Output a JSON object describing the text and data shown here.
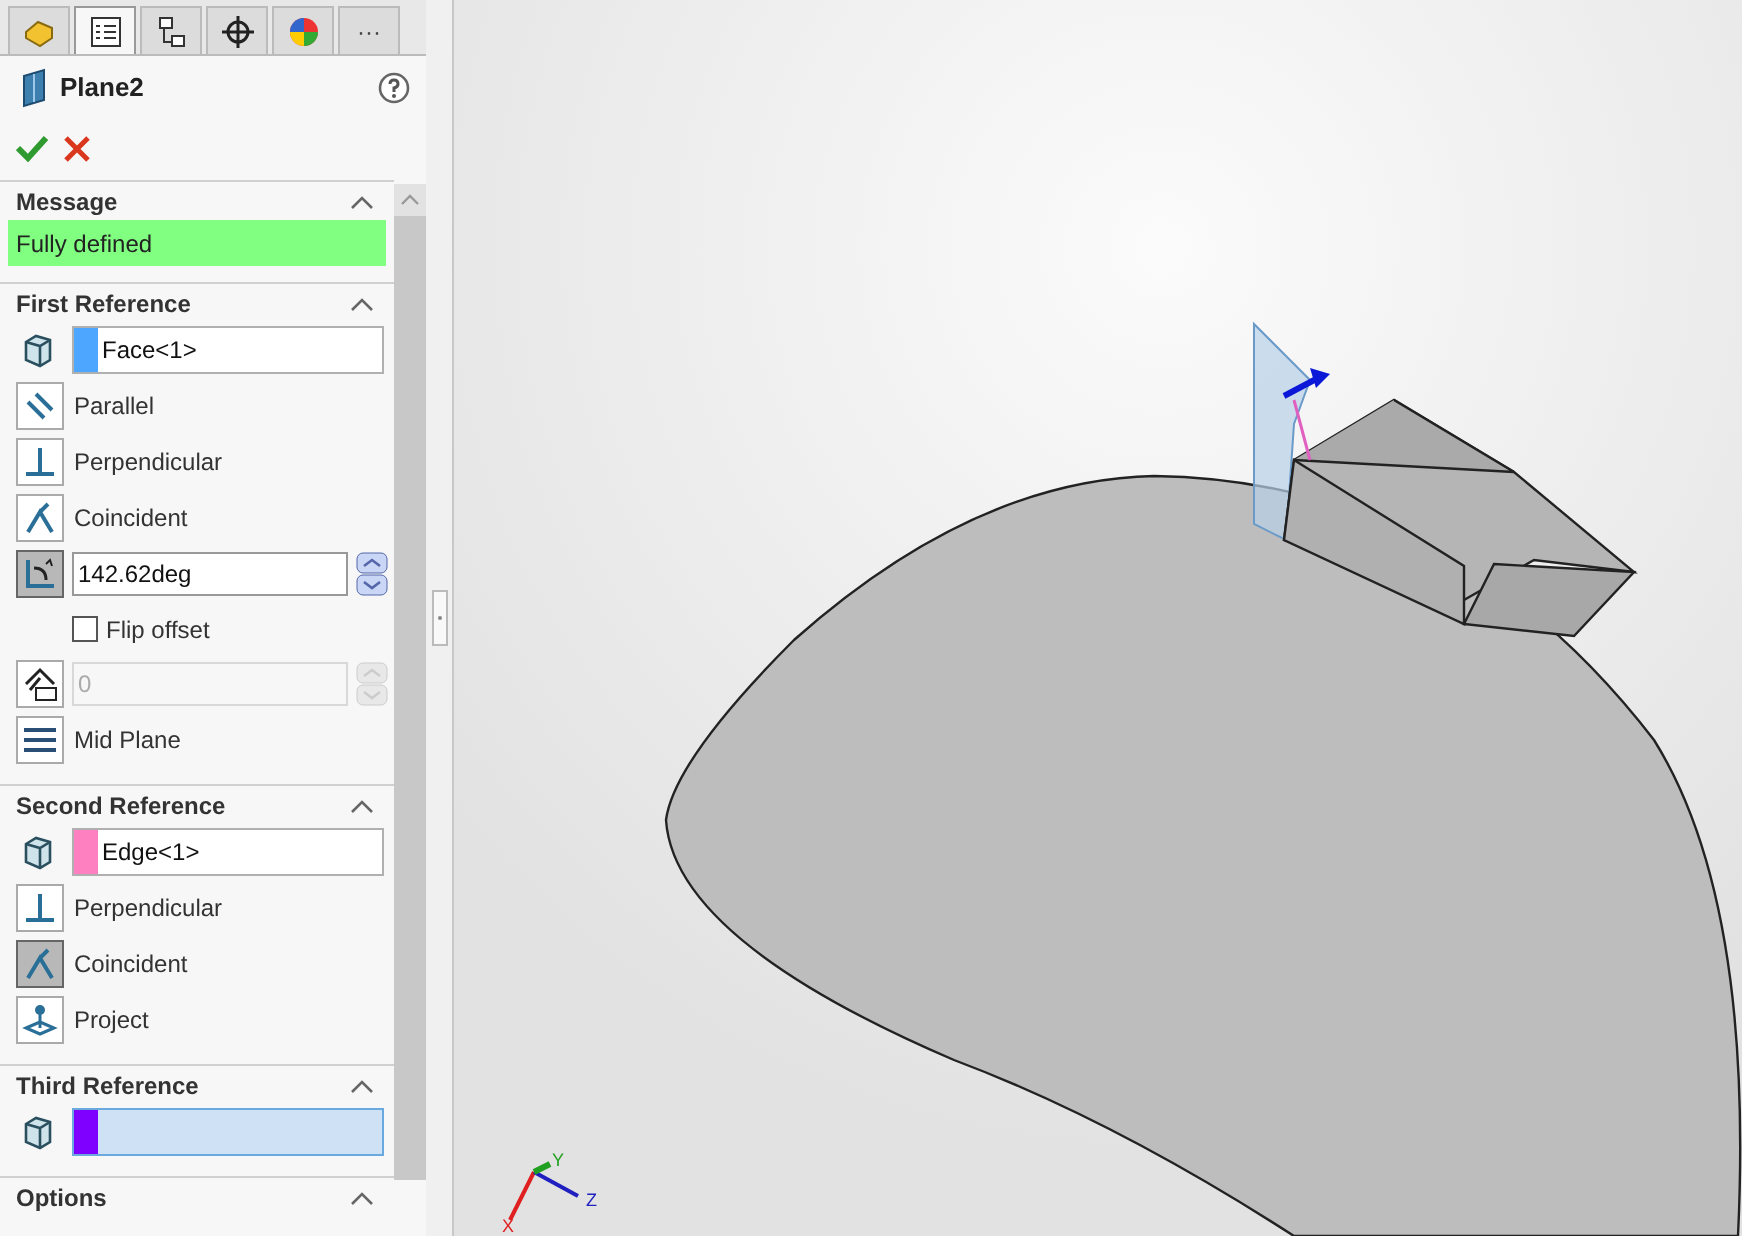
{
  "tabs": [
    {
      "selected": false
    },
    {
      "selected": true
    },
    {
      "selected": false
    },
    {
      "selected": false
    },
    {
      "selected": false
    },
    {
      "selected": false,
      "label": "···"
    }
  ],
  "feature": {
    "title": "Plane2"
  },
  "message": {
    "title": "Message",
    "text": "Fully defined",
    "expanded": true
  },
  "references": [
    {
      "title": "First Reference",
      "expanded": true,
      "field": {
        "value": "Face<1>",
        "color": "#4da6ff",
        "focused": false
      },
      "options": [
        {
          "kind": "parallel",
          "label": "Parallel",
          "selected": false
        },
        {
          "kind": "perpendicular",
          "label": "Perpendicular",
          "selected": false
        },
        {
          "kind": "coincident",
          "label": "Coincident",
          "selected": false
        },
        {
          "kind": "angle",
          "value": "142.62deg",
          "selected": true,
          "disabled": false
        },
        {
          "kind": "checkbox",
          "label": "Flip offset",
          "checked": false
        },
        {
          "kind": "distance",
          "value": "0",
          "selected": false,
          "disabled": true
        },
        {
          "kind": "midplane",
          "label": "Mid Plane",
          "selected": false
        }
      ]
    },
    {
      "title": "Second Reference",
      "expanded": true,
      "field": {
        "value": "Edge<1>",
        "color": "#ff80c0",
        "focused": false
      },
      "options": [
        {
          "kind": "perpendicular",
          "label": "Perpendicular",
          "selected": false
        },
        {
          "kind": "coincident",
          "label": "Coincident",
          "selected": true
        },
        {
          "kind": "project",
          "label": "Project",
          "selected": false
        }
      ]
    },
    {
      "title": "Third Reference",
      "expanded": true,
      "field": {
        "color": "#8000ff",
        "focused": true
      }
    }
  ],
  "options_section": {
    "title": "Options",
    "expanded": true
  },
  "triad": {
    "x": "X",
    "y": "Y",
    "z": "Z"
  }
}
